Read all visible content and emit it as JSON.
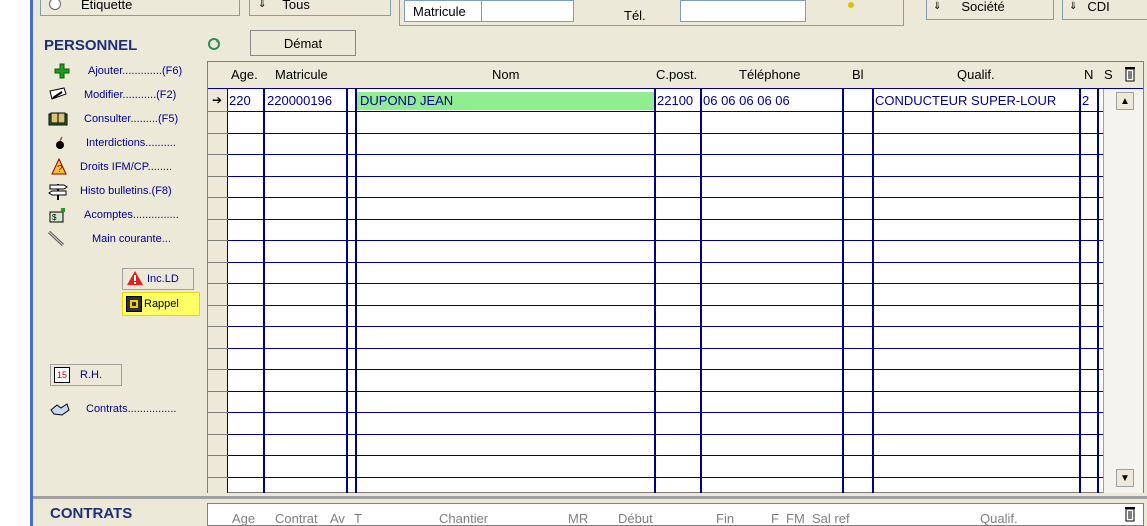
{
  "top": {
    "etiquette_label": "Etiquette",
    "tous_label": "Tous",
    "matricule_label": "Matricule",
    "tel_label": "Tél.",
    "societe_label": "Société",
    "cdi_label": "CDI"
  },
  "personnel": {
    "title": "PERSONNEL",
    "demat_label": "Démat",
    "menu": [
      {
        "label": "Ajouter.............(F6)",
        "icon": "green-plus-icon"
      },
      {
        "label": "Modifier...........(F2)",
        "icon": "edit-icon"
      },
      {
        "label": "Consulter.........(F5)",
        "icon": "book-icon"
      },
      {
        "label": "Interdictions..........",
        "icon": "bomb-icon"
      },
      {
        "label": "Droits IFM/CP........",
        "icon": "warning-person-icon"
      },
      {
        "label": "Histo bulletins.(F8)",
        "icon": "signpost-icon"
      },
      {
        "label": "Acomptes...............",
        "icon": "money-icon"
      },
      {
        "label": "Main courante...",
        "icon": "pen-icon"
      }
    ],
    "inc_ld_label": "Inc.LD",
    "rappel_label": "Rappel",
    "rh_label": "R.H.",
    "contrats_label": "Contrats................",
    "highlight_color": "#ffff66"
  },
  "grid": {
    "columns": [
      "Age.",
      "Matricule",
      "Nom",
      "C.post.",
      "Téléphone",
      "Bl",
      "Qualif.",
      "N",
      "S"
    ],
    "rows": [
      {
        "age": "220",
        "matricule": "220000196",
        "nom": "DUPOND JEAN",
        "cpost": "22100",
        "telephone": "06 06 06 06 06",
        "bl": "",
        "qualif": "CONDUCTEUR SUPER-LOUR",
        "n": "2",
        "s": ""
      }
    ],
    "selected_row_color": "#90ee90"
  },
  "contrats": {
    "title": "CONTRATS",
    "columns": [
      "Age",
      "Contrat",
      "Av",
      "T",
      "Chantier",
      "MR",
      "Début",
      "Fin",
      "F",
      "FM",
      "Sal ref",
      "Qualif."
    ]
  }
}
